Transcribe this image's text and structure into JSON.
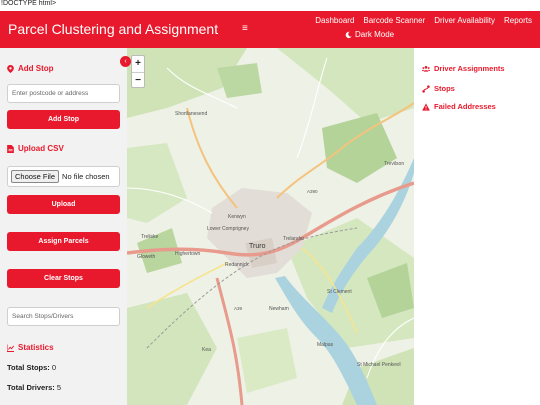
{
  "leak_text": "!DOCTYPE html>",
  "navbar": {
    "title": "Parcel Clustering and Assignment",
    "menu_glyph": "≡",
    "links": [
      "Dashboard",
      "Barcode Scanner",
      "Driver Availability",
      "Reports"
    ],
    "dark_mode_label": "Dark Mode",
    "color": "#e8192c"
  },
  "sidebar": {
    "collapse_glyph": "‹",
    "add_stop": {
      "title": "Add Stop",
      "icon": "map-marker-icon",
      "input_placeholder": "Enter postcode or address",
      "button_label": "Add Stop"
    },
    "upload_csv": {
      "title": "Upload CSV",
      "icon": "file-icon",
      "choose_file_label": "Choose File",
      "no_file_label": "No file chosen",
      "button_label": "Upload"
    },
    "assign_button_label": "Assign Parcels",
    "clear_button_label": "Clear Stops",
    "search_placeholder": "Search Stops/Drivers",
    "statistics": {
      "title": "Statistics",
      "icon": "chart-icon",
      "total_stops_label": "Total Stops:",
      "total_stops_value": "0",
      "total_drivers_label": "Total Drivers:",
      "total_drivers_value": "5"
    }
  },
  "map": {
    "zoom_in": "+",
    "zoom_out": "−",
    "places": [
      "Shortlanesend",
      "Kenwyn",
      "Lower Comprigney",
      "Truro",
      "Trelander",
      "Redannick",
      "Highertown",
      "Treliske",
      "Gloweth",
      "Newham",
      "St Clement",
      "Malpas",
      "Trevilson",
      "Kea",
      "St Michael Penkevil",
      "A390",
      "A39"
    ]
  },
  "right_panel": {
    "items": [
      {
        "label": "Driver Assignments",
        "icon": "users-icon"
      },
      {
        "label": "Stops",
        "icon": "route-icon"
      },
      {
        "label": "Failed Addresses",
        "icon": "warning-icon"
      }
    ]
  }
}
